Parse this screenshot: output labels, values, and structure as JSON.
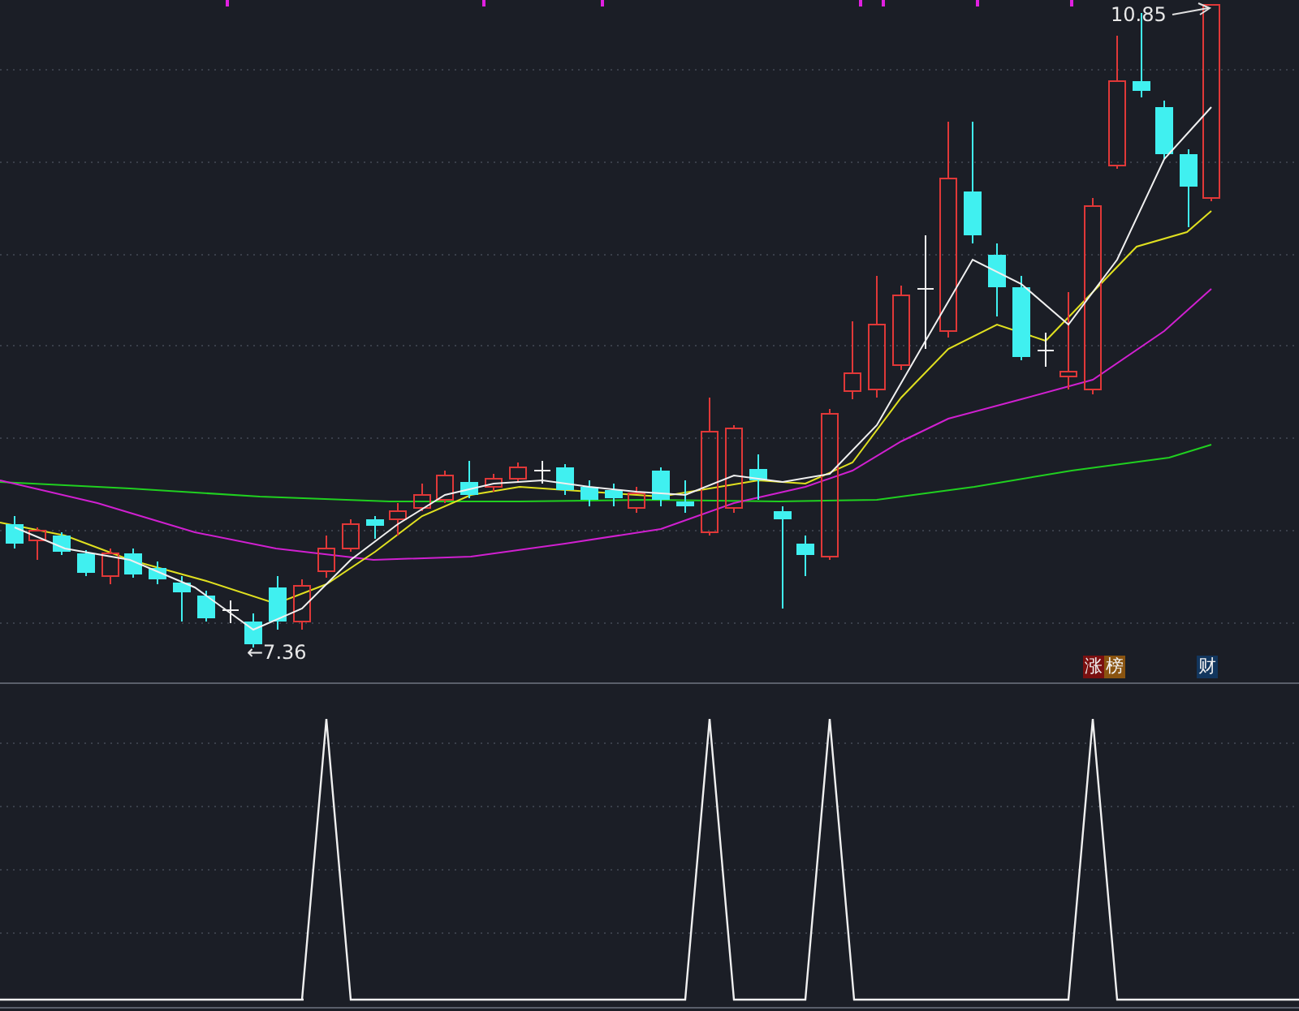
{
  "price_chart": {
    "high_label": "10.85",
    "low_label": "←7.36",
    "tags": [
      {
        "text": "涨",
        "color": "#7a1010"
      },
      {
        "text": "榜",
        "color": "#8a5410"
      },
      {
        "text": "财",
        "color": "#12365e"
      }
    ]
  }
}
